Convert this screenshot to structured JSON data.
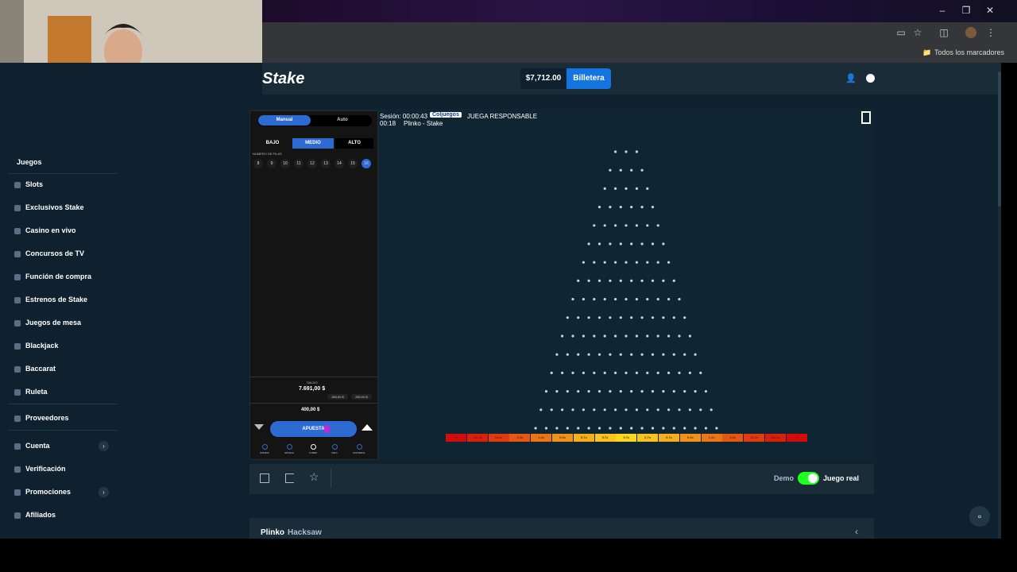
{
  "browser": {
    "bookmarks_label": "Todos los marcadores"
  },
  "header": {
    "logo": "Stake",
    "balance": "$7,712.00",
    "wallet_button": "Billetera"
  },
  "sidebar": {
    "items": [
      {
        "label": "Juegos"
      },
      {
        "label": "Slots"
      },
      {
        "label": "Exclusivos Stake"
      },
      {
        "label": "Casino en vivo"
      },
      {
        "label": "Concursos de TV"
      },
      {
        "label": "Función de compra"
      },
      {
        "label": "Estrenos de Stake"
      },
      {
        "label": "Juegos de mesa"
      },
      {
        "label": "Blackjack"
      },
      {
        "label": "Baccarat"
      },
      {
        "label": "Ruleta"
      },
      {
        "label": "Proveedores"
      },
      {
        "label": "Cuenta"
      },
      {
        "label": "Verificación"
      },
      {
        "label": "Promociones"
      },
      {
        "label": "Afiliados"
      }
    ]
  },
  "game": {
    "mode_tabs": [
      "Manual",
      "Auto"
    ],
    "risk_tabs": [
      "BAJO",
      "MEDIO",
      "ALTO"
    ],
    "rows_label": "NÚMERO DE FILAS",
    "row_options": [
      "8",
      "9",
      "10",
      "11",
      "12",
      "13",
      "14",
      "15",
      "16"
    ],
    "selected_rows": "16",
    "session_time": "Sesión: 00:00:43",
    "coljuegos": "Coljuegos",
    "responsible": "JUEGA RESPONSABLE",
    "clock": "00:18",
    "game_title_small": "Plinko - Stake",
    "balance_label": "SALDO",
    "balance_value": "7.691,00 $",
    "chip_1": "280,00 $",
    "chip_2": "280,00 $",
    "bet_amount": "400,00 $",
    "bet_button": "APUESTA",
    "bottom_nav": [
      "SONIDO",
      "MÚSICA",
      "TURBO",
      "INFO",
      "HISTORIAL"
    ],
    "multipliers": [
      "1K",
      "100.2x",
      "14.4x",
      "3.2x",
      "1.2x",
      "0.9x",
      "0.7x",
      "0.7x",
      "0.7x",
      "0.7x",
      "0.7x",
      "0.9x",
      "1.2x",
      "3.2x",
      "14.4x",
      "100.2x",
      "1K"
    ],
    "mult_colors": [
      "#d50b0b",
      "#d9200d",
      "#df3a10",
      "#e55713",
      "#ea7516",
      "#ef9219",
      "#f5ae1c",
      "#f9c41e",
      "#fbd81f",
      "#f9c41e",
      "#f5ae1c",
      "#ef9219",
      "#ea7516",
      "#e55713",
      "#df3a10",
      "#d9200d",
      "#d50b0b"
    ]
  },
  "gamebar": {
    "demo_label": "Demo",
    "real_label": "Juego real"
  },
  "bottom": {
    "game_name": "Plinko",
    "provider": "Hacksaw"
  }
}
